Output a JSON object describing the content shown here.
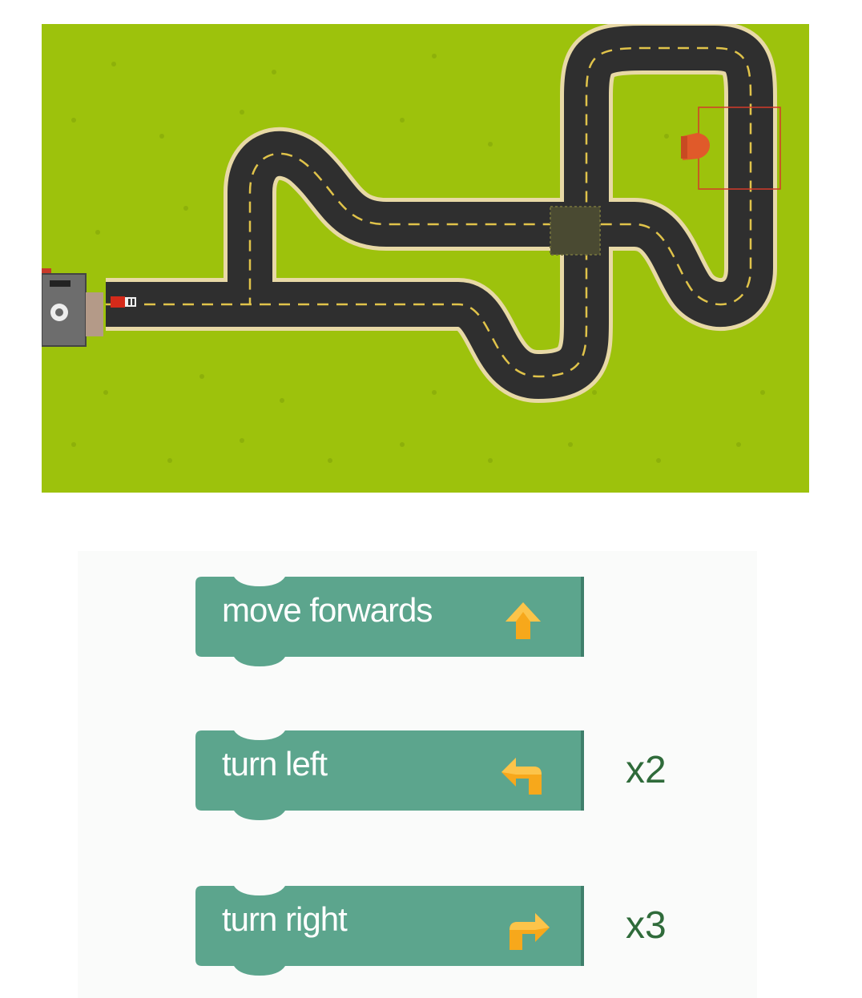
{
  "board": {
    "colors": {
      "grass": "#9dc20c",
      "road": "#2f2f2f",
      "road_edge": "#e8d9a6",
      "lane_marking": "#e0c34a",
      "crossing": "#6b6a3a",
      "player_car": "#d42a1a",
      "target": "#e05a2a",
      "target_box": "#d43a2a"
    },
    "icons": [
      "garage-icon",
      "car-icon",
      "traffic-light-icon"
    ]
  },
  "palette": {
    "blocks": [
      {
        "id": "move",
        "label": "move forwards",
        "icon": "arrow-up-icon",
        "count": ""
      },
      {
        "id": "left",
        "label": "turn left",
        "icon": "turn-left-icon",
        "count": "x2"
      },
      {
        "id": "right",
        "label": "turn right",
        "icon": "turn-right-icon",
        "count": "x3"
      }
    ],
    "colors": {
      "block": "#5ca58d",
      "block_dark": "#3f7f6b",
      "icon": "#f7a81b",
      "count_text": "#2f6b3a"
    }
  }
}
